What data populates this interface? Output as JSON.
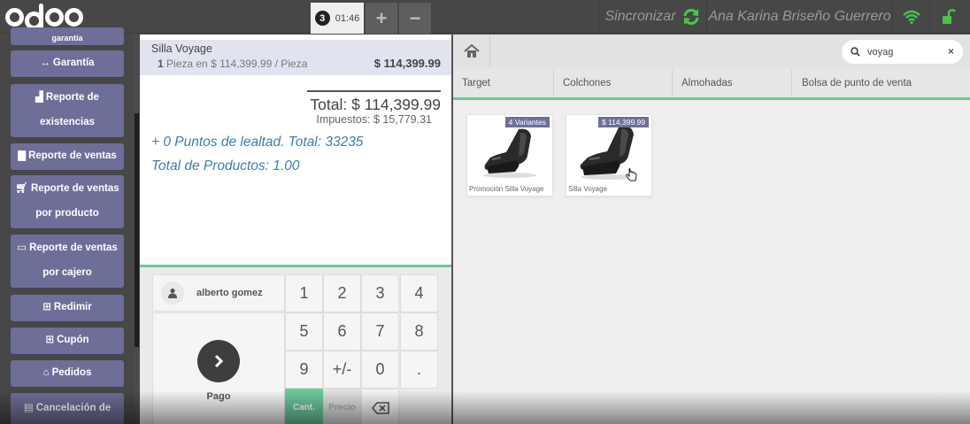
{
  "header": {
    "order_number": "3",
    "order_time": "01:46",
    "add_label": "+",
    "remove_label": "−",
    "sync_label": "Sincronizar",
    "user_name": "Ana Karina Briseño Guerrero"
  },
  "sidebar": {
    "items": [
      {
        "label": "garantía"
      },
      {
        "label": "Garantía",
        "icon": "↔"
      },
      {
        "line1": "Reporte de",
        "line2": "existencias",
        "icon": "bar-chart-icon"
      },
      {
        "label": "Reporte de ventas",
        "icon": "book-icon"
      },
      {
        "line1": "Reporte de ventas",
        "line2": "por producto",
        "icon": "cart-icon"
      },
      {
        "line1": "Reporte de ventas",
        "line2": "por cajero",
        "icon": "credit-card-icon"
      },
      {
        "label": "Redimir",
        "icon": "gift-icon"
      },
      {
        "label": "Cupón",
        "icon": "gift-icon"
      },
      {
        "label": "Pedidos",
        "icon": "bank-icon"
      },
      {
        "label": "Cancelación de",
        "icon": "table-icon"
      }
    ]
  },
  "order": {
    "line": {
      "product": "Silla Voyage",
      "qty": "1",
      "unit_text": "Pieza en $ 114,399.99 / Pieza",
      "price": "$ 114,399.99"
    },
    "total": "Total: $ 114,399.99",
    "taxes": "Impuestos: $ 15,779.31",
    "loyalty": "+ 0 Puntos de lealtad. Total: 33235",
    "total_products": "Total de Productos: 1.00"
  },
  "numpad": {
    "customer": "alberto gomez",
    "payment": "Pago",
    "keys": [
      "1",
      "2",
      "3",
      "4",
      "5",
      "6",
      "7",
      "8",
      "9",
      "+/-",
      "0",
      "."
    ],
    "mode_qty": "Cant.",
    "mode_price": "Precio"
  },
  "products": {
    "search": {
      "value": "voyag"
    },
    "categories": [
      "Target",
      "Colchones",
      "Almohadas",
      "Bolsa de punto de venta"
    ],
    "cards": [
      {
        "name": "Promoción Silla Voyage",
        "tag": "4 Variantes"
      },
      {
        "name": "Silla Voyage",
        "tag": "$ 114,399.99"
      }
    ]
  },
  "colors": {
    "accent_green": "#6ec89b",
    "sidebar_button": "#6e6f98",
    "topbar": "#474747",
    "loyalty_text": "#3c7fa8"
  }
}
